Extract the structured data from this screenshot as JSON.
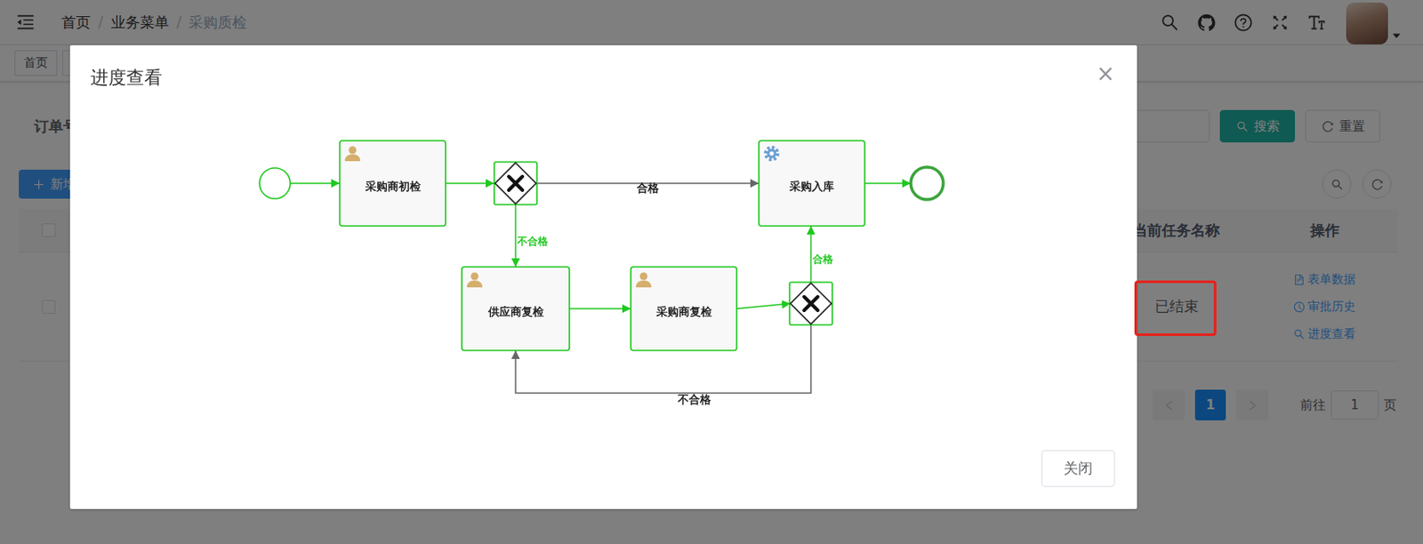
{
  "navbar": {
    "breadcrumb": [
      {
        "label": "首页",
        "current": false
      },
      {
        "label": "业务菜单",
        "current": false
      },
      {
        "label": "采购质检",
        "current": true
      }
    ],
    "separator": "/"
  },
  "tags": [
    {
      "label": "首页",
      "selected": false
    },
    {
      "label": "",
      "selected": false
    }
  ],
  "search_form": {
    "label": "订单号",
    "buttons": [
      {
        "label": "搜索",
        "kind": "primary"
      },
      {
        "label": "重置",
        "kind": "default"
      }
    ]
  },
  "toolbar": {
    "add_button": "新增"
  },
  "table": {
    "header_checked": false,
    "columns": [
      "当前任务名称",
      "操作"
    ],
    "rows": [
      {
        "checked": false,
        "status": "已结束",
        "highlighted": true,
        "actions": [
          "表单数据",
          "审批历史",
          "进度查看"
        ]
      }
    ]
  },
  "pagination": {
    "prev_disabled": true,
    "next_disabled": true,
    "pages": [
      {
        "label": "1",
        "selected": true
      }
    ],
    "goto_label": "前往",
    "goto_value": "1",
    "page_suffix": "页"
  },
  "modal": {
    "title": "进度查看",
    "close": "×",
    "footer_button": "关闭",
    "diagram": {
      "nodes": [
        {
          "kind": "start",
          "completed": true
        },
        {
          "kind": "user-task",
          "label": "采购商初检",
          "completed": true
        },
        {
          "kind": "gateway",
          "completed": true
        },
        {
          "kind": "service-task",
          "label": "采购入库",
          "completed": true
        },
        {
          "kind": "end",
          "completed": true
        },
        {
          "kind": "user-task",
          "label": "供应商复检",
          "completed": true
        },
        {
          "kind": "user-task",
          "label": "采购商复检",
          "completed": true
        },
        {
          "kind": "gateway",
          "completed": true
        }
      ],
      "edges": [
        {
          "taken": true
        },
        {
          "taken": true
        },
        {
          "label": "合格",
          "taken": false
        },
        {
          "label": "不合格",
          "taken": true
        },
        {
          "taken": true
        },
        {
          "taken": true
        },
        {
          "label": "合格",
          "taken": true
        },
        {
          "label": "不合格",
          "taken": false
        },
        {
          "taken": true
        }
      ]
    }
  }
}
